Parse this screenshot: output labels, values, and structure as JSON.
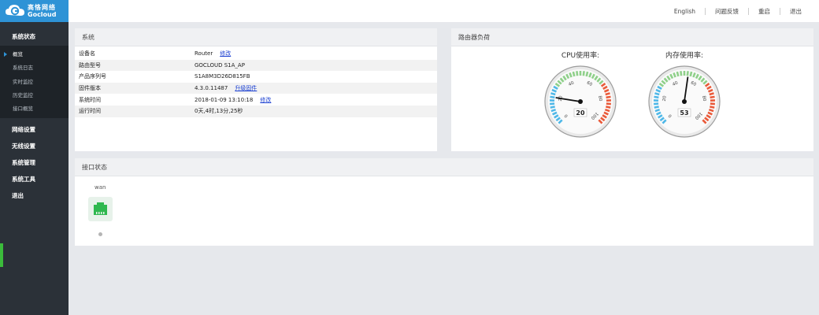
{
  "brand": {
    "name_cn": "高恪网络",
    "name_en": "Gocloud"
  },
  "colors": {
    "brand_blue": "#2e93d6",
    "sidebar_bg": "#2b3138",
    "link": "#1a3fd1"
  },
  "sidebar": {
    "groups": [
      {
        "label": "系统状态",
        "items": [
          "概览",
          "系统日志",
          "实时监控",
          "历史监控",
          "接口概览"
        ],
        "active": "概览"
      },
      {
        "label": "网络设置"
      },
      {
        "label": "无线设置"
      },
      {
        "label": "系统管理"
      },
      {
        "label": "系统工具"
      },
      {
        "label": "退出"
      }
    ]
  },
  "topbar": {
    "links": [
      "English",
      "问题反馈",
      "重启",
      "退出"
    ]
  },
  "system_panel": {
    "title": "系统",
    "rows": [
      {
        "key": "设备名",
        "value": "Router",
        "link": "修改"
      },
      {
        "key": "路由型号",
        "value": "GOCLOUD S1A_AP"
      },
      {
        "key": "产品序列号",
        "value": "S1A8M3D26D815FB"
      },
      {
        "key": "固件版本",
        "value": "4.3.0.11487",
        "link": "升级固件"
      },
      {
        "key": "系统时间",
        "value": "2018-01-09 13:10:18",
        "link": "修改"
      },
      {
        "key": "运行时间",
        "value": "0天,4时,13分,25秒"
      }
    ]
  },
  "load_panel": {
    "title": "路由器负荷",
    "gauges": [
      {
        "title": "CPU使用率:",
        "value": 20,
        "readout": "20",
        "ticks": [
          "0",
          "20",
          "40",
          "60",
          "80",
          "100"
        ]
      },
      {
        "title": "内存使用率:",
        "value": 53,
        "readout": "53",
        "ticks": [
          "0",
          "20",
          "40",
          "60",
          "80",
          "100"
        ]
      }
    ]
  },
  "interface_panel": {
    "title": "接口状态",
    "ports": [
      {
        "name": "wan",
        "icon": "ethernet-port-icon",
        "color": "#2fb84f"
      }
    ]
  }
}
